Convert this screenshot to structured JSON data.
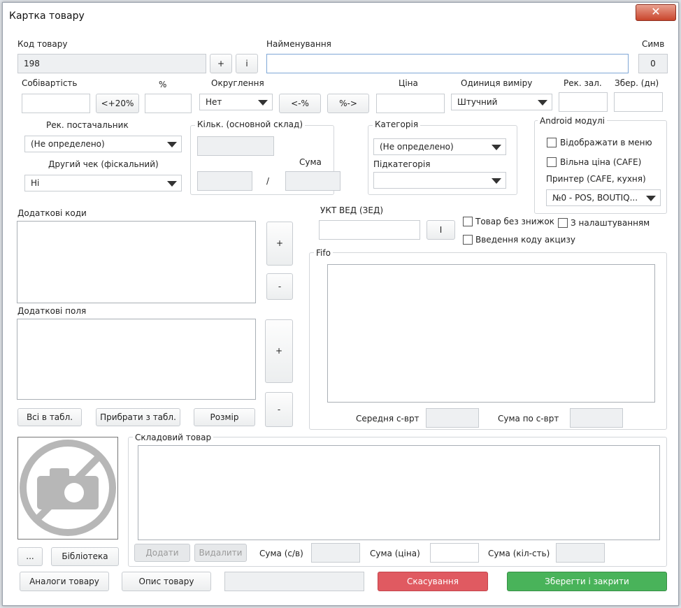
{
  "window": {
    "title": "Картка товару",
    "close_label": "✕"
  },
  "code": {
    "label": "Код товару",
    "value": "198",
    "plus": "+",
    "info": "i"
  },
  "name": {
    "label": "Найменування",
    "value": ""
  },
  "sym": {
    "label": "Симв",
    "value": "0"
  },
  "cost": {
    "label": "Собівартість",
    "plus20": "<+20%"
  },
  "percent": {
    "label": "%"
  },
  "rounding": {
    "label": "Округлення",
    "value": "Нет",
    "left": "<-%",
    "right": "%->"
  },
  "price": {
    "label": "Ціна"
  },
  "unit": {
    "label": "Одиниця виміру",
    "value": "Штучний"
  },
  "rek": {
    "label": "Рек. зал."
  },
  "zber": {
    "label": "Збер. (дн)"
  },
  "supplier": {
    "label": "Рек. постачальник",
    "value": "(Не определено)"
  },
  "fiscal": {
    "label": "Другий чек (фіскальний)",
    "value": "Ні"
  },
  "qty": {
    "title": "Кільк. (основной склад)",
    "sum_label": "Сума",
    "slash": "/"
  },
  "category": {
    "title": "Категорія",
    "value": "(Не определено)",
    "sub_label": "Підкатегорія",
    "sub_value": ""
  },
  "android": {
    "title": "Android модулі",
    "show_menu": "Відображати в меню",
    "free_price": "Вільна ціна (CAFE)",
    "printer_label": "Принтер (CAFE, кухня)",
    "printer_value": "№0 - POS, BOUTIQ..."
  },
  "extra_codes": {
    "label": "Додаткові коди",
    "plus": "+",
    "minus": "-"
  },
  "extra_fields": {
    "label": "Додаткові поля",
    "plus": "+",
    "minus": "-"
  },
  "ukt": {
    "label": "УКТ ВЕД (ЗЕД)",
    "btn": "I"
  },
  "flags": {
    "no_discount": "Товар без знижок",
    "with_settings": "З налаштуванням",
    "excise": "Введення коду акцизу"
  },
  "fifo": {
    "title": "Fifo",
    "avg_label": "Середня с-врт",
    "sum_label": "Сума по с-врт"
  },
  "table_buttons": {
    "all": "Всі в табл.",
    "remove": "Прибрати з табл.",
    "size": "Розмір"
  },
  "stock": {
    "title": "Складовий товар",
    "add": "Додати",
    "delete": "Видалити",
    "sum_cost": "Сума (с/в)",
    "sum_price": "Сума (ціна)",
    "sum_qty": "Сума (кіл-сть)"
  },
  "image": {
    "more": "...",
    "library": "Бібліотека"
  },
  "footer": {
    "analogs": "Аналоги товару",
    "description": "Опис товару",
    "cancel": "Скасування",
    "save": "Зберегти і закрити"
  },
  "colors": {
    "cancel": "#e05a61",
    "save": "#49b35a"
  }
}
